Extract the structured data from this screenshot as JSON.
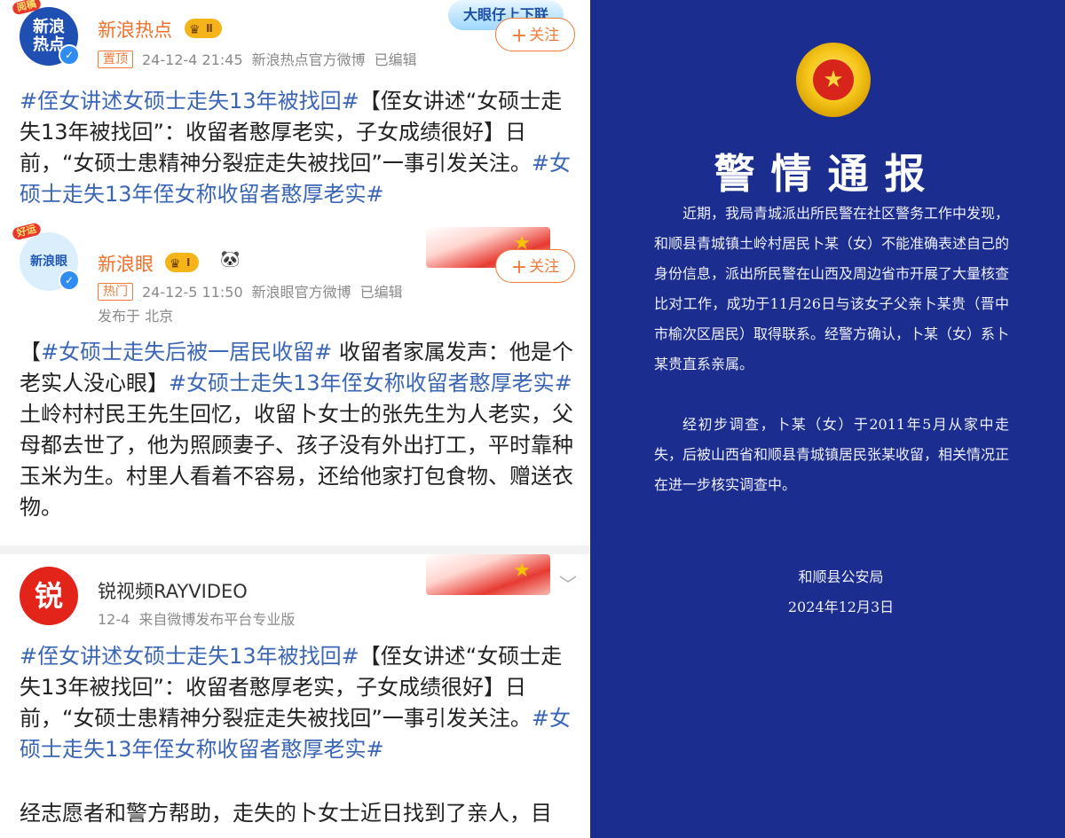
{
  "posts": [
    {
      "ribbon": "阅稿",
      "avatar_text": "新浪热点",
      "username": "新浪热点",
      "level": "Ⅱ",
      "tag": "置顶",
      "time": "24-12-4 21:45",
      "source": "新浪热点官方微博",
      "edited": "已编辑",
      "follow_label": "关注",
      "banner_text": "大眼仔上下联",
      "body": [
        {
          "t": "#侄女讲述女硕士走失13年被找回#",
          "h": true
        },
        {
          "t": "【侄女讲述“女硕士走失13年被找回”：收留者憨厚老实，子女成绩很好】日前，“女硕士患精神分裂症走失被找回”一事引发关注。",
          "h": false
        },
        {
          "t": "#女硕士走失13年侄女称收留者憨厚老实#",
          "h": true
        }
      ]
    },
    {
      "ribbon": "好运",
      "avatar_text": "新浪眼",
      "username": "新浪眼",
      "level": "Ⅰ",
      "panda": "🐼",
      "tag": "热门",
      "time": "24-12-5 11:50",
      "source": "新浪眼官方微博",
      "edited": "已编辑",
      "location": "发布于 北京",
      "follow_label": "关注",
      "body": [
        {
          "t": "【",
          "h": false
        },
        {
          "t": "#女硕士走失后被一居民收留#",
          "h": true
        },
        {
          "t": " 收留者家属发声：他是个老实人没心眼】",
          "h": false
        },
        {
          "t": "#女硕士走失13年侄女称收留者憨厚老实#",
          "h": true
        },
        {
          "t": "土岭村村民王先生回忆，收留卜女士的张先生为人老实，父母都去世了，他为照顾妻子、孩子没有外出打工，平时靠种玉米为生。村里人看着不容易，还给他家打包食物、赠送衣物。",
          "h": false
        }
      ]
    },
    {
      "avatar_text": "锐",
      "username": "锐视频RAYVIDEO",
      "time": "12-4",
      "source": "来自微博发布平台专业版",
      "body": [
        {
          "t": "#侄女讲述女硕士走失13年被找回#",
          "h": true
        },
        {
          "t": "【侄女讲述“女硕士走失13年被找回”：收留者憨厚老实，子女成绩很好】日前，“女硕士患精神分裂症走失被找回”一事引发关注。",
          "h": false
        },
        {
          "t": "#女硕士走失13年侄女称收留者憨厚老实#",
          "h": true
        }
      ],
      "body2": "经志愿者和警方帮助，走失的卜女士近日找到了亲人，目"
    }
  ],
  "notice": {
    "title": "警情通报",
    "para1": "近期，我局青城派出所民警在社区警务工作中发现，和顺县青城镇土岭村居民卜某（女）不能准确表述自己的身份信息，派出所民警在山西及周边省市开展了大量核查比对工作，成功于11月26日与该女子父亲卜某贵（晋中市榆次区居民）取得联系。经警方确认，卜某（女）系卜某贵直系亲属。",
    "para2": "经初步调查，卜某（女）于2011年5月从家中走失，后被山西省和顺县青城镇居民张某收留，相关情况正在进一步核实调查中。",
    "org": "和顺县公安局",
    "date": "2024年12月3日"
  },
  "colors": {
    "accent": "#f07a3a",
    "link": "#3a66b5",
    "notice_bg": "#1b2d8f"
  }
}
